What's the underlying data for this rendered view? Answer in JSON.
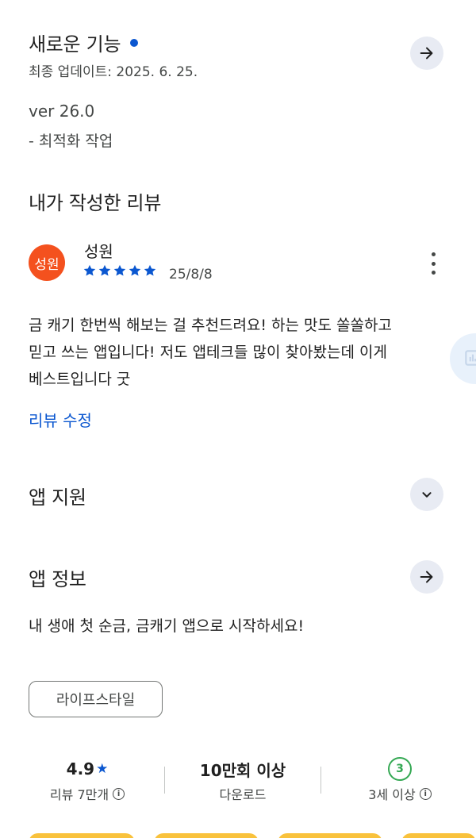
{
  "whats_new": {
    "title": "새로운 기능",
    "updated": "최종 업데이트: 2025. 6. 25.",
    "version": "ver 26.0",
    "notes": "- 최적화 작업"
  },
  "my_review": {
    "title": "내가 작성한 리뷰",
    "avatar_text": "성원",
    "reviewer": "성원",
    "stars": 5,
    "date": "25/8/8",
    "text_lines": [
      "금 캐기 한번씩 해보는 걸 추천드려요! 하는 맛도 쏠쏠하고",
      "믿고 쓰는 앱입니다! 저도 앱테크들 많이 찾아봤는데 이게",
      "베스트입니다 굿"
    ],
    "edit_label": "리뷰 수정"
  },
  "app_support": {
    "title": "앱 지원"
  },
  "app_info": {
    "title": "앱 정보",
    "description": "내 생애 첫 순금, 금캐기 앱으로 시작하세요!",
    "category": "라이프스타일"
  },
  "stats": {
    "rating_value": "4.9",
    "rating_sub": "리뷰 7만개",
    "downloads_value": "10만회 이상",
    "downloads_sub": "다운로드",
    "age_badge": "3",
    "age_sub": "3세 이상"
  },
  "colors": {
    "accent_blue": "#0b57d0",
    "avatar_orange": "#f4511e",
    "age_green": "#34a853",
    "button_bg": "#e8ebf3"
  }
}
